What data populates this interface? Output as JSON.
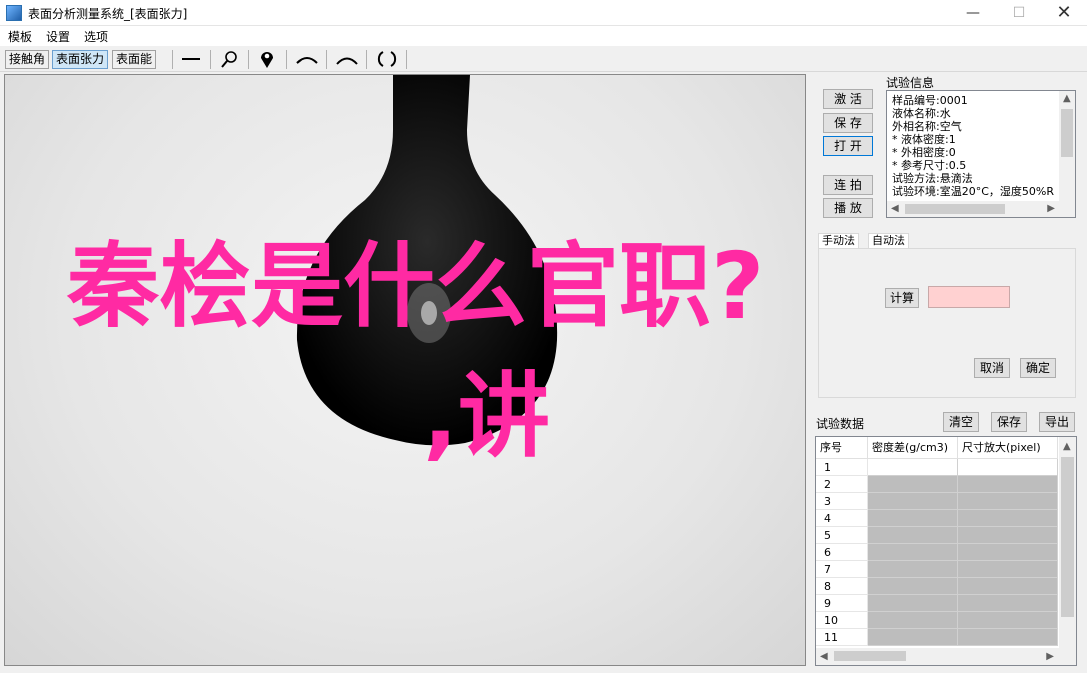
{
  "window": {
    "title": "表面分析测量系统_[表面张力]"
  },
  "menu": {
    "items": [
      "模板",
      "设置",
      "选项"
    ]
  },
  "toolbar": {
    "tabs": [
      "接触角",
      "表面张力",
      "表面能"
    ],
    "active_tab": 1
  },
  "overlay": {
    "line1": "秦桧是什么官职?",
    "line2": ",讲"
  },
  "controls": {
    "activate": "激 活",
    "save": "保 存",
    "open": "打 开",
    "capture": "连 拍",
    "play": "播 放"
  },
  "info": {
    "heading": "试验信息",
    "lines": [
      "样品编号:0001",
      "液体名称:水",
      "外相名称:空气",
      "* 液体密度:1",
      "* 外相密度:0",
      "* 参考尺寸:0.5",
      "试验方法:悬滴法",
      "试验环境:室温20°C，湿度50%R"
    ]
  },
  "method_tabs": {
    "tab1": "手动法",
    "tab2": "自动法"
  },
  "calc": {
    "compute": "计算",
    "cancel": "取消",
    "confirm": "确定"
  },
  "data": {
    "heading": "试验数据",
    "clear": "清空",
    "save": "保存",
    "export": "导出",
    "columns": [
      "序号",
      "密度差(g/cm3)",
      "尺寸放大(pixel)"
    ],
    "rows": [
      "1",
      "2",
      "3",
      "4",
      "5",
      "6",
      "7",
      "8",
      "9",
      "10",
      "11"
    ]
  }
}
